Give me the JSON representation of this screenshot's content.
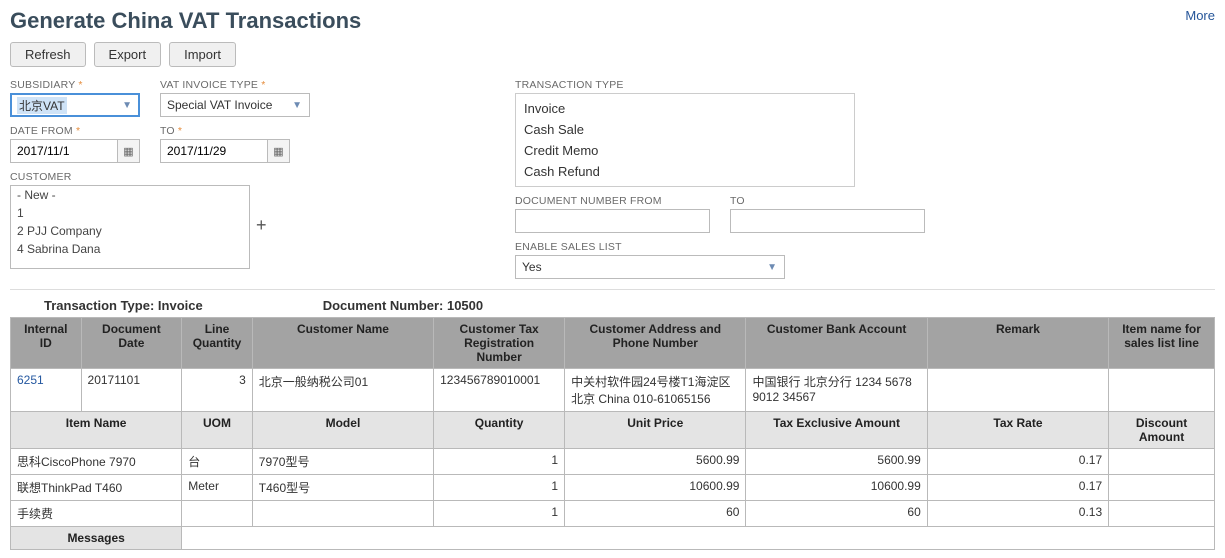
{
  "header": {
    "title": "Generate China VAT Transactions",
    "more": "More"
  },
  "buttons": {
    "refresh": "Refresh",
    "export": "Export",
    "import": "Import"
  },
  "form": {
    "subsidiary": {
      "label": "SUBSIDIARY",
      "value": "北京VAT"
    },
    "vat_invoice_type": {
      "label": "VAT INVOICE TYPE",
      "value": "Special VAT Invoice"
    },
    "date_from": {
      "label": "DATE FROM",
      "value": "2017/11/1"
    },
    "date_to": {
      "label": "TO",
      "value": "2017/11/29"
    },
    "customer": {
      "label": "CUSTOMER",
      "options": [
        "- New -",
        "1",
        "2 PJJ Company",
        "4 Sabrina Dana"
      ]
    },
    "transaction_type": {
      "label": "TRANSACTION TYPE",
      "options": [
        "Invoice",
        "Cash Sale",
        "Credit Memo",
        "Cash Refund"
      ]
    },
    "doc_from": {
      "label": "DOCUMENT NUMBER FROM",
      "value": ""
    },
    "doc_to": {
      "label": "TO",
      "value": ""
    },
    "enable_sales": {
      "label": "ENABLE SALES LIST",
      "value": "Yes"
    }
  },
  "meta": {
    "tx_type_label": "Transaction Type:",
    "tx_type_value": "Invoice",
    "doc_num_label": "Document Number:",
    "doc_num_value": "10500"
  },
  "table": {
    "headers": {
      "internal_id": "Internal ID",
      "doc_date": "Document Date",
      "line_qty": "Line Quantity",
      "cust_name": "Customer Name",
      "cust_tax": "Customer Tax Registration Number",
      "cust_addr": "Customer Address and Phone Number",
      "cust_bank": "Customer Bank Account",
      "remark": "Remark",
      "item_sales": "Item name for sales list line"
    },
    "row": {
      "internal_id": "6251",
      "doc_date": "20171101",
      "line_qty": "3",
      "cust_name": "北京一般纳税公司01",
      "cust_tax": "123456789010001",
      "cust_addr": "中关村软件园24号楼T1海淀区北京 China 010-61065156",
      "cust_bank": "中国银行 北京分行 1234 5678 9012 34567",
      "remark": "",
      "item_sales": ""
    },
    "sub_headers": {
      "item_name": "Item Name",
      "uom": "UOM",
      "model": "Model",
      "quantity": "Quantity",
      "unit_price": "Unit Price",
      "tax_excl": "Tax Exclusive Amount",
      "tax_rate": "Tax Rate",
      "discount": "Discount Amount"
    },
    "items": [
      {
        "name": "思科CiscoPhone 7970",
        "uom": "台",
        "model": "7970型号",
        "qty": "1",
        "price": "5600.99",
        "excl": "5600.99",
        "rate": "0.17",
        "disc": ""
      },
      {
        "name": "联想ThinkPad T460",
        "uom": "Meter",
        "model": "T460型号",
        "qty": "1",
        "price": "10600.99",
        "excl": "10600.99",
        "rate": "0.17",
        "disc": ""
      },
      {
        "name": "手续费",
        "uom": "",
        "model": "",
        "qty": "1",
        "price": "60",
        "excl": "60",
        "rate": "0.13",
        "disc": ""
      }
    ],
    "messages_label": "Messages"
  }
}
